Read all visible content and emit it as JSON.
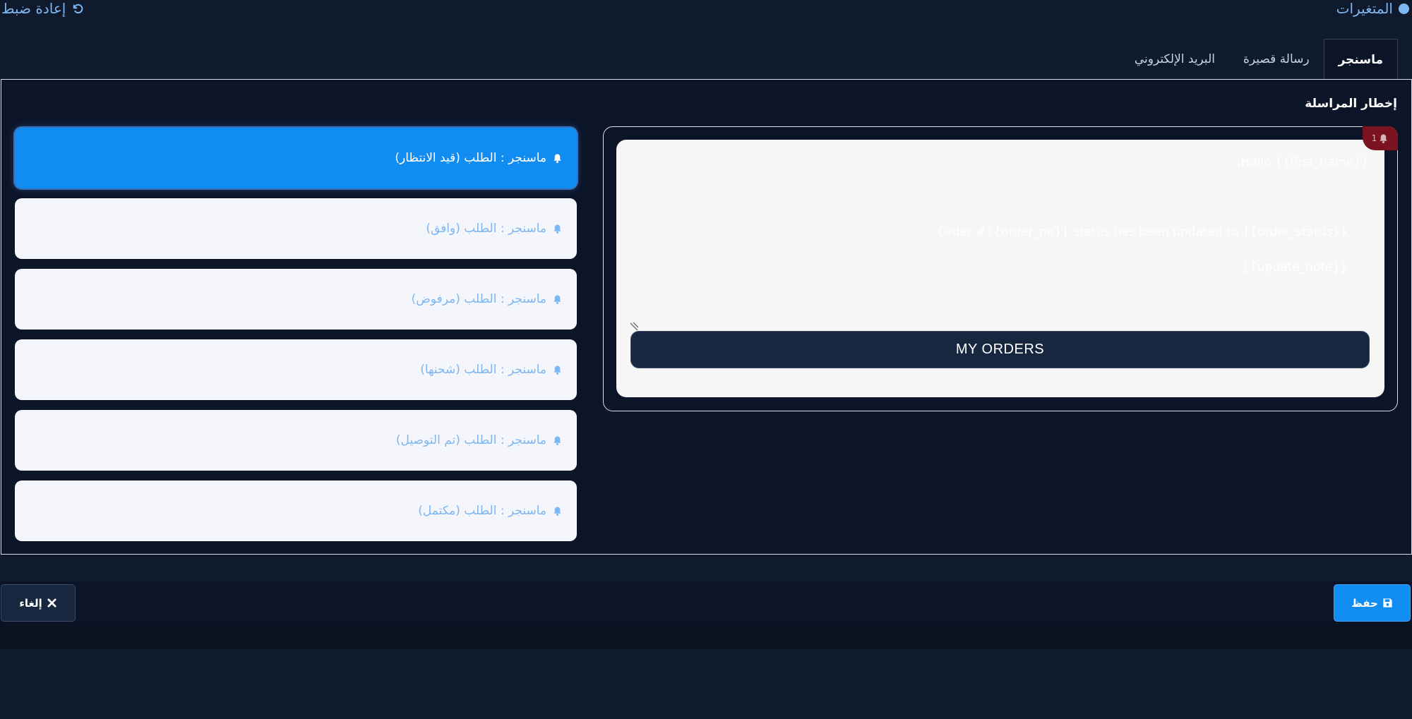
{
  "header": {
    "variables_label": "المتغيرات",
    "reset_label": "إعادة ضبط"
  },
  "tabs": [
    {
      "label": "ماسنجر",
      "active": true
    },
    {
      "label": "رسالة قصيرة",
      "active": false
    },
    {
      "label": "البريد الإلكتروني",
      "active": false
    }
  ],
  "section": {
    "title": "إخطار المراسلة"
  },
  "preview": {
    "badge_count": "1",
    "line1": "Hello {{first_name}},",
    "line2": "Order #{{order_no}} status has been updated to {{order_status}}.",
    "line3": "{{update_note}}",
    "button_label": "MY ORDERS"
  },
  "status_items": [
    {
      "label": "ماسنجر : الطلب (قيد الانتظار)",
      "active": true
    },
    {
      "label": "ماسنجر : الطلب (وافق)",
      "active": false
    },
    {
      "label": "ماسنجر : الطلب (مرفوض)",
      "active": false
    },
    {
      "label": "ماسنجر : الطلب (شحنها)",
      "active": false
    },
    {
      "label": "ماسنجر : الطلب (تم التوصيل)",
      "active": false
    },
    {
      "label": "ماسنجر : الطلب (مكتمل)",
      "active": false
    }
  ],
  "footer": {
    "save_label": "حفظ",
    "cancel_label": "إلغاء"
  },
  "colors": {
    "background": "#0f1a2d",
    "accent": "#118cf0",
    "link": "#7eb7f0",
    "badge": "#7a1220"
  }
}
